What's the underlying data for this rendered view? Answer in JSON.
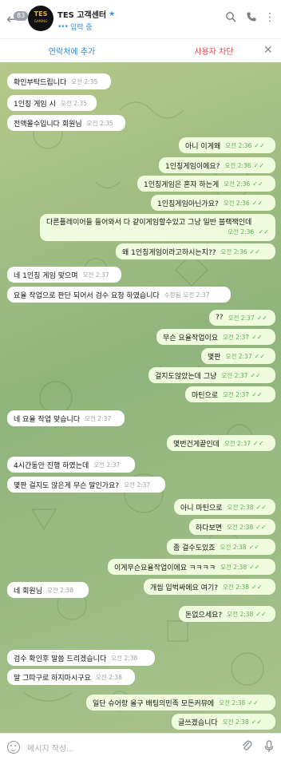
{
  "header": {
    "unread_count": "83",
    "title": "TES 고객센터",
    "status": "입력 중",
    "avatar_text": "TES",
    "avatar_sub": "GAMING"
  },
  "action_bar": {
    "add_contact": "연락처에 추가",
    "block_user": "사용자 차단"
  },
  "messages": [
    {
      "dir": "in",
      "text": "확인부탁드립니다",
      "time": "오전 2:35"
    },
    {
      "dir": "in",
      "text": "1인칭 게임 시",
      "time": "오전 2:35"
    },
    {
      "dir": "in",
      "text": "전액몰수입니다 회원님",
      "time": "오전 2:35"
    },
    {
      "dir": "out",
      "text": "아니 이게왜",
      "time": "오전 2:36"
    },
    {
      "dir": "out",
      "text": "1인칭게임이에요?",
      "time": "오전 2:36"
    },
    {
      "dir": "out",
      "text": "1인칭게임은 혼자 하는게",
      "time": "오전 2:36"
    },
    {
      "dir": "out",
      "text": "1인칭게임아닌가요?",
      "time": "오전 2:36"
    },
    {
      "dir": "out",
      "text": "다른플레이어들 들어와서 다 같이게임할수있고 그냥 일반 블랙잭인데",
      "time": "오전 2:36"
    },
    {
      "dir": "out",
      "text": "왜 1인칭게임이라고하시는지??",
      "time": "오전 2:36"
    },
    {
      "dir": "in",
      "text": "네 1인칭 게임 맞으며",
      "time": "오전 2:37"
    },
    {
      "dir": "in",
      "text": "요율 작업으로 판단 되어서 검수 요청 하였습니다",
      "time": "오전 2:37",
      "edited": "수정됨"
    },
    {
      "dir": "out",
      "text": "??",
      "time": "오전 2:37"
    },
    {
      "dir": "out",
      "text": "무슨 요율작업이요",
      "time": "오전 2:37"
    },
    {
      "dir": "out",
      "text": "몇판",
      "time": "오전 2:37"
    },
    {
      "dir": "out",
      "text": "걸지도않았는데 그냥",
      "time": "오전 2:37"
    },
    {
      "dir": "out",
      "text": "마틴으로",
      "time": "오전 2:37"
    },
    {
      "dir": "in",
      "text": "네 요율 작업 맞습니다",
      "time": "오전 2:37"
    },
    {
      "dir": "out",
      "text": "몇번건게끝인데",
      "time": "오전 2:37"
    },
    {
      "dir": "in",
      "text": "4시간동안 진행 하였는데",
      "time": "오전 2:37"
    },
    {
      "dir": "in",
      "text": "몇판 걸지도 않은게 무슨 말인가요?",
      "time": "오전 2:37"
    },
    {
      "dir": "out",
      "text": "아니 마틴으로",
      "time": "오전 2:38"
    },
    {
      "dir": "out",
      "text": "하다보면",
      "time": "오전 2:38"
    },
    {
      "dir": "out",
      "text": "좀 걸수도있죠",
      "time": "오전 2:38"
    },
    {
      "dir": "out",
      "text": "이게무슨요율작업이에요 ㅋㅋㅋㅋ",
      "time": "오전 2:38"
    },
    {
      "dir": "out",
      "text": "개씹 입벅싸에요 여기?",
      "time": "오전 2:38"
    },
    {
      "dir": "in",
      "text": "네 회원님",
      "time": "오전 2:38"
    },
    {
      "dir": "out",
      "text": "돈없으세요?",
      "time": "오전 2:38"
    },
    {
      "dir": "in",
      "text": "검수 확인후 말씀 드리겠습니다",
      "time": "오전 2:38"
    },
    {
      "dir": "in",
      "text": "말 그따구로 하지마시구요",
      "time": "오전 2:38"
    },
    {
      "dir": "out",
      "text": "일단 슈어랑 올구 배팅의민족 모든커뮤에",
      "time": "오전 2:38"
    },
    {
      "dir": "out",
      "text": "글쓰겠습니다",
      "time": "오전 2:38"
    }
  ],
  "input": {
    "placeholder": "메시지 작성..."
  },
  "icons": {
    "back": "back-arrow-icon",
    "search": "search-icon",
    "phone": "phone-icon",
    "menu": "more-vertical-icon",
    "close": "close-icon",
    "emoji": "emoji-icon",
    "attach": "paperclip-icon",
    "mic": "microphone-icon"
  },
  "colors": {
    "outgoing_bubble": "#effdde",
    "incoming_bubble": "#ffffff",
    "accent": "#2f8ad1",
    "block_red": "#e0474c",
    "read_check": "#4fae4e"
  }
}
